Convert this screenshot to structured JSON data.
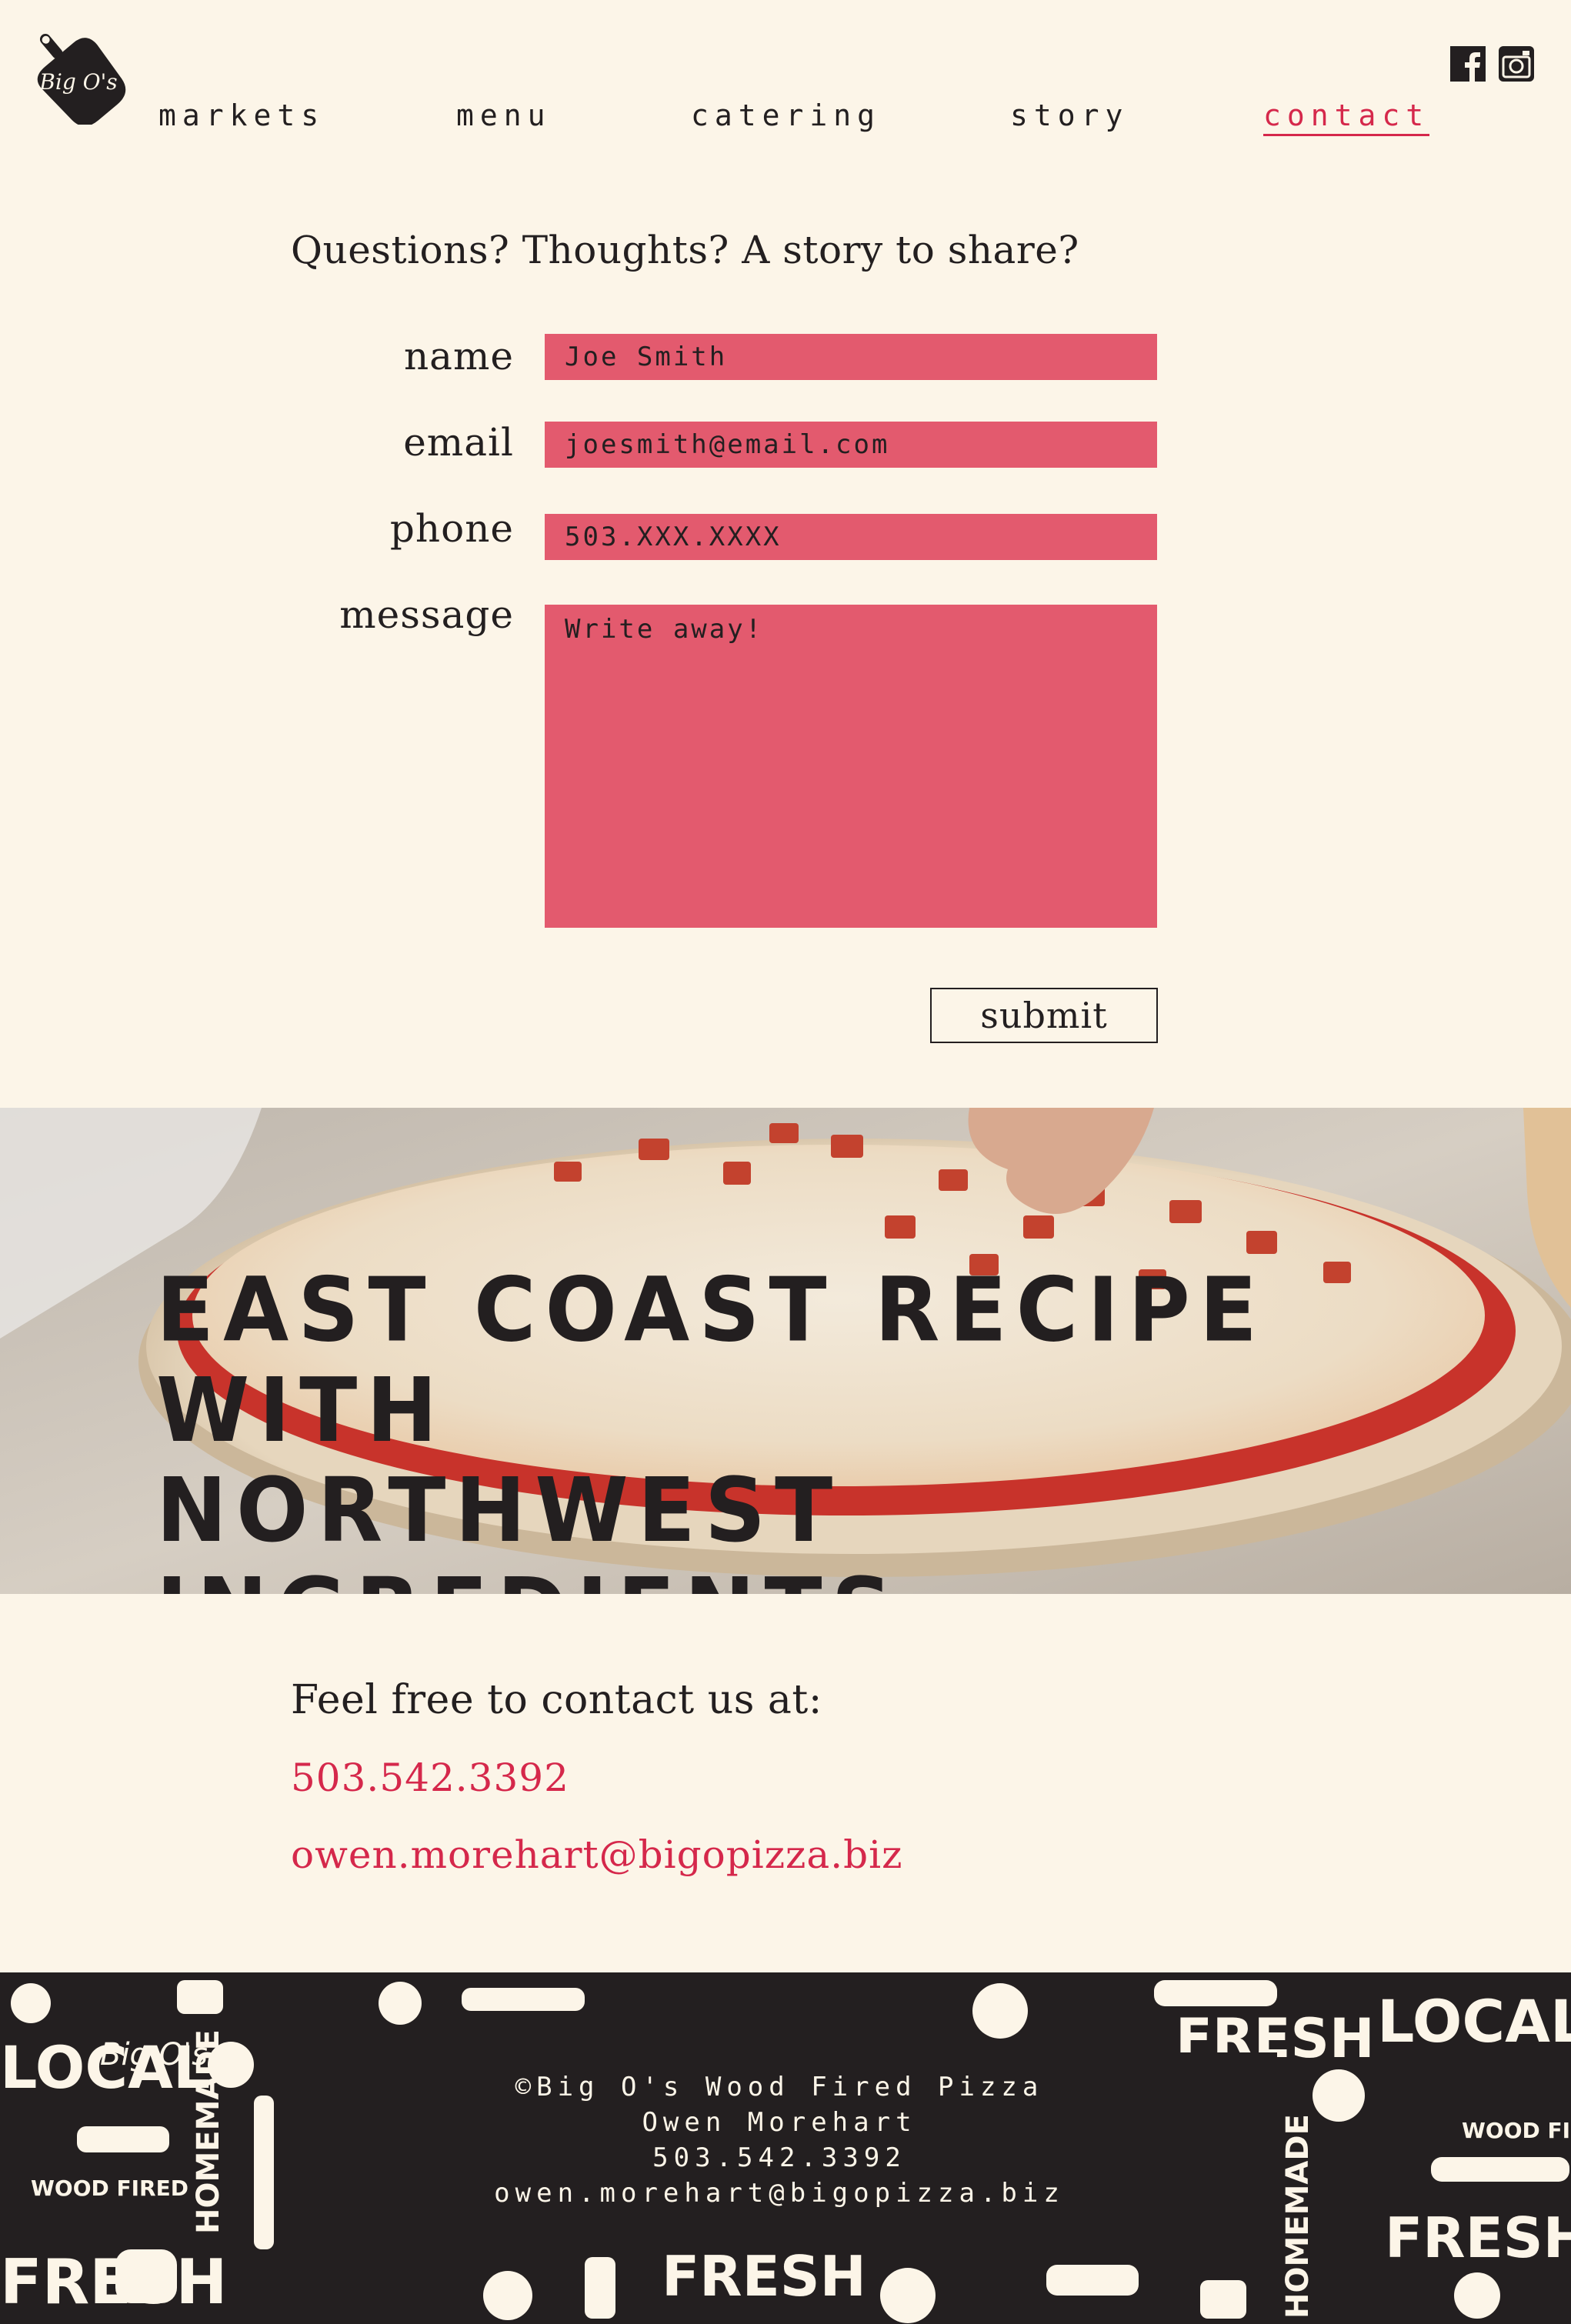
{
  "brand": {
    "logo_text": "Big O's"
  },
  "nav": {
    "items": [
      {
        "label": "markets"
      },
      {
        "label": "menu"
      },
      {
        "label": "catering"
      },
      {
        "label": "story"
      },
      {
        "label": "contact",
        "active": true
      }
    ]
  },
  "social": {
    "icons": [
      "facebook-icon",
      "instagram-icon"
    ]
  },
  "form": {
    "headline": "Questions? Thoughts? A story to share?",
    "name_label": "name",
    "name_placeholder": "Joe Smith",
    "email_label": "email",
    "email_placeholder": "joesmith@email.com",
    "phone_label": "phone",
    "phone_placeholder": "503.XXX.XXXX",
    "message_label": "message",
    "message_placeholder": "Write away!",
    "submit_label": "submit"
  },
  "hero": {
    "title": "EAST COAST RECIPE WITH\nNORTHWEST INGREDIENTS"
  },
  "contact": {
    "intro": "Feel free to contact us at:",
    "phone": "503.542.3392",
    "email": "owen.morehart@bigopizza.biz"
  },
  "footer": {
    "copyright": "©Big O's Wood Fired Pizza",
    "owner": "Owen Morehart",
    "phone": "503.542.3392",
    "email": "owen.morehart@bigopizza.biz",
    "pattern_words": [
      "LOCAL",
      "FRESH",
      "HOMEMADE",
      "WOOD FIRED",
      "Big O's"
    ]
  },
  "colors": {
    "background": "#fcf5e8",
    "accent": "#d5284b",
    "field": "#e35a6e",
    "ink": "#231f20"
  }
}
